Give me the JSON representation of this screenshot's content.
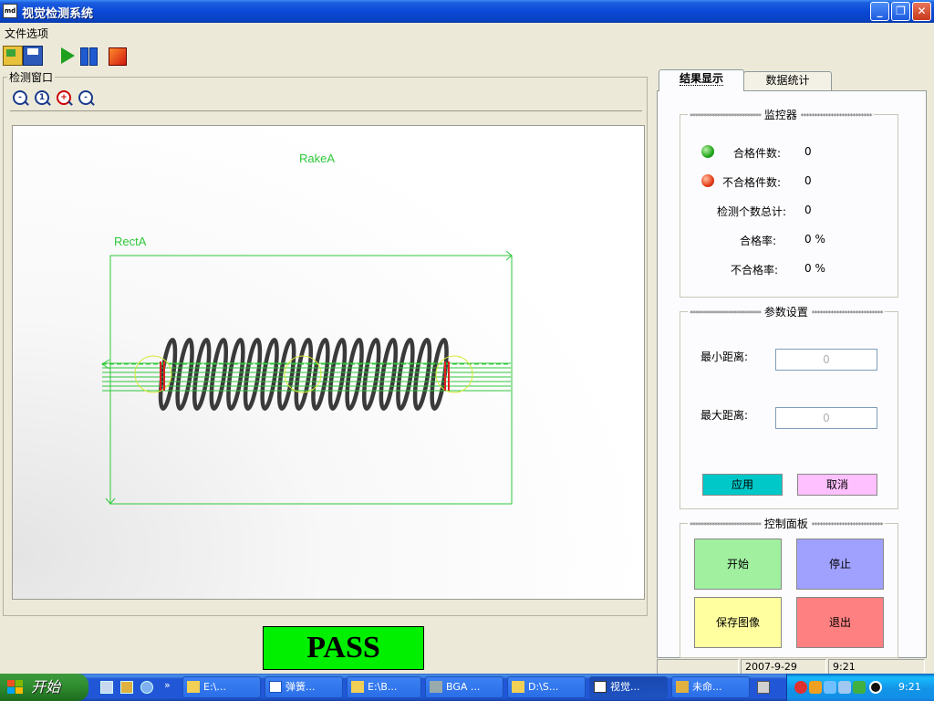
{
  "window": {
    "title": "视觉检测系统",
    "app_icon_text": "md"
  },
  "menu": {
    "items": [
      "文件选项"
    ]
  },
  "detect": {
    "legend": "检测窗口",
    "rake_label": "RakeA",
    "rect_label": "RectA"
  },
  "result": {
    "text": "PASS"
  },
  "tabs": [
    "结果显示",
    "数据统计"
  ],
  "monitor": {
    "legend": "监控器",
    "stars": "**************************",
    "pass_label": "合格件数:",
    "pass_value": "0",
    "fail_label": "不合格件数:",
    "fail_value": "0",
    "total_label": "检测个数总计:",
    "total_value": "0",
    "pass_rate_label": "合格率:",
    "pass_rate_value": "0 %",
    "fail_rate_label": "不合格率:",
    "fail_rate_value": "0 %"
  },
  "params": {
    "legend": "参数设置",
    "min_label": "最小距离:",
    "min_placeholder": "0",
    "max_label": "最大距离:",
    "max_placeholder": "0",
    "apply": "应用",
    "cancel": "取消"
  },
  "control": {
    "legend": "控制面板",
    "start": "开始",
    "stop": "停止",
    "save_image": "保存图像",
    "exit": "退出"
  },
  "status": {
    "date": "2007-9-29",
    "time": "9:21"
  },
  "taskbar": {
    "start": "开始",
    "tasks": [
      "E:\\...",
      "弹簧...",
      "E:\\B...",
      "BGA ...",
      "D:\\S...",
      "视觉...",
      "未命..."
    ],
    "clock": "9:21"
  },
  "colors": {
    "pass": "#00f000",
    "overlay": "#2ec83a",
    "title_bar": "#0a49d6"
  }
}
